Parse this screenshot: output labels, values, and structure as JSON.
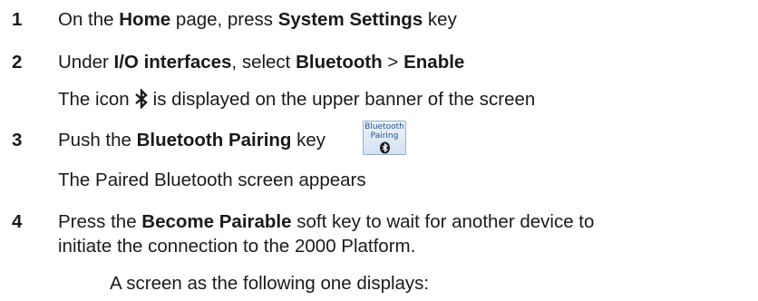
{
  "steps": [
    {
      "number": "1",
      "t1": "On the ",
      "b1": "Home",
      "t2": " page, press ",
      "b2": "System Settings",
      "t3": " key"
    },
    {
      "number": "2",
      "t1": "Under ",
      "b1": "I/O interfaces",
      "t2": ", select ",
      "b2": "Bluetooth",
      "t3": " > ",
      "b3": "Enable",
      "result_before": "The icon",
      "result_after": "is displayed on the upper banner of the screen",
      "result_icon": "bluetooth-icon"
    },
    {
      "number": "3",
      "t1": "Push the ",
      "b1": "Bluetooth Pairing",
      "t2": " key",
      "key_label_line1": "Bluetooth",
      "key_label_line2": "Pairing",
      "key_icon": "bluetooth-icon",
      "result": "The Paired Bluetooth screen appears"
    },
    {
      "number": "4",
      "t1": "Press the ",
      "b1": "Become Pairable",
      "t2": " soft key to wait for another device to",
      "line2": "initiate the connection to the 2000 Platform.",
      "result": "A screen as the following one displays:"
    }
  ],
  "colors": {
    "text": "#1a1a1a",
    "key_text": "#1c4f9c",
    "key_border": "#8fb0d2",
    "key_bg": "#dbe8f5"
  }
}
